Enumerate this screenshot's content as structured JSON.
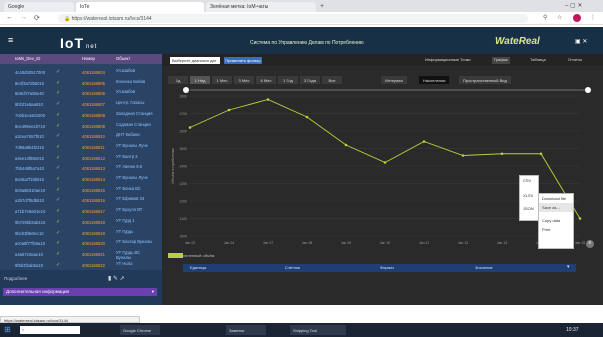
{
  "browser": {
    "tabs": [
      {
        "label": "Google",
        "active": false
      },
      {
        "label": "IoTe",
        "active": true
      },
      {
        "label": "Зелёная метка: IoM-чаты",
        "active": false
      }
    ],
    "url": "https://waterreal.iotsam.ru/lvcs/3144",
    "icons": [
      "back-icon",
      "forward-icon",
      "reload-icon",
      "lock-icon",
      "star-icon",
      "profile-icon",
      "menu-icon"
    ]
  },
  "app": {
    "logo": "IoT",
    "logo_suffix": "net",
    "title": "Система по Управлению Делам по Потреблению",
    "brand": "WateReal",
    "header_buttons": [
      "Информация по Приборам",
      "Графики",
      "Таблица",
      "Отчеты"
    ]
  },
  "sidebar": {
    "header": [
      "IoMs_Dev_ID",
      "Номер",
      "Объект"
    ],
    "rows": [
      {
        "id": "4c48d30517000",
        "sn": "4081166804",
        "name": "Ул.Шабов"
      },
      {
        "id": "8e4f3a7d55010",
        "sn": "4081166805",
        "name": "Колонка Бойов"
      },
      {
        "id": "8e8cf37a55e40",
        "sn": "4081166806",
        "name": "Ул.Шабов"
      },
      {
        "id": "9bf1f1e8aa810",
        "sn": "4081166807",
        "name": "Центр. Гапасы"
      },
      {
        "id": "7c6b1e4a01000",
        "sn": "4081166808",
        "name": "Западная Станция"
      },
      {
        "id": "8ec499ee1b710",
        "sn": "4081166809",
        "name": "Садовая Станция"
      },
      {
        "id": "a3cea7657f010",
        "sn": "4081166810",
        "name": "ДНТ Кабани"
      },
      {
        "id": "7d96a9b4f2210",
        "sn": "4081166811",
        "name": "УТ Вуналы Луче"
      },
      {
        "id": "a4ee14f86e010",
        "sn": "4081166812",
        "name": "УТ Бантр 3"
      },
      {
        "id": "7bb448f5a7a10",
        "sn": "4081166813",
        "name": "УТ Авеню 9.5"
      },
      {
        "id": "8a46a7f18b810",
        "sn": "4081166814",
        "name": "УТ Вуналы Луче"
      },
      {
        "id": "8c9a68310ae10",
        "sn": "4081166815",
        "name": "УТ Бонка ВС"
      },
      {
        "id": "a2b7d7f8db810",
        "sn": "4081166816",
        "name": "УТ Ефимов 34"
      },
      {
        "id": "a71b7e8a01e10",
        "sn": "4081166817",
        "name": "УТ Бухуло ВТ"
      },
      {
        "id": "9b7295b3ab410",
        "sn": "4081166818",
        "name": "УТ Гурд 1"
      },
      {
        "id": "9bcb3f8e6ec10",
        "sn": "4081166819",
        "name": "УТ Гурдь"
      },
      {
        "id": "ac0a8f77f56a10",
        "sn": "4081166820",
        "name": "УТ Бахтар Вуналы"
      },
      {
        "id": "a4a6710aae10",
        "sn": "4081166821",
        "name": "УТ Гурдь ВС Вуналы"
      },
      {
        "id": "9f5b3f2ab6a10",
        "sn": "4081166822",
        "name": "УТ Ноло"
      }
    ],
    "footer_label": "Подробнее",
    "add_info": "Дополнительная информация"
  },
  "toolbar": {
    "date_value": "Выберите диапазон дат",
    "show_button": "Применить фильтр",
    "right_buttons": [
      "Информационные Точки",
      "График",
      "Таблица",
      "Отчеты"
    ]
  },
  "range_tabs": [
    "1д",
    "1 Нед",
    "1 Мес",
    "3 Мес",
    "6 Мес",
    "1 Год",
    "3 Года",
    "Все"
  ],
  "view_tabs": [
    {
      "label": "Интервал",
      "selected": false
    },
    {
      "label": "Накопления",
      "selected": true
    },
    {
      "label": "Пространственный Вид",
      "selected": false
    }
  ],
  "chart_data": {
    "type": "line",
    "title": "",
    "xlabel": "",
    "ylabel": "Объём потребления",
    "x": [
      "Jan 02",
      "Jan 04",
      "Jan 07",
      "Jan 08",
      "Jan 09",
      "Jan 10",
      "Jan 11",
      "Jan 12",
      "Jan 13",
      "Jan 14",
      "Jan 15"
    ],
    "series": [
      {
        "name": "Накопленный объём",
        "values": [
          1620,
          1720,
          1780,
          1680,
          1520,
          1420,
          1540,
          1460,
          1470,
          1470,
          1100
        ]
      }
    ],
    "color": "#bcd03a",
    "background": "#2a2a2a",
    "grid": true
  },
  "table": {
    "headers": [
      "Единица",
      "Счётчик",
      "Формат",
      "Значение"
    ]
  },
  "context_menu": {
    "formats": [
      "CSV",
      "XLSX",
      "JSON"
    ],
    "actions": [
      "Download file",
      "Save as...",
      "Copy data",
      "Print"
    ]
  },
  "statusbar": "https://waterreal.iotsam.ru/lvcs/3144",
  "taskbar": {
    "items": [
      "Google Chrome",
      "Заметки",
      "Snipping Tool"
    ],
    "clock": "10:37"
  }
}
